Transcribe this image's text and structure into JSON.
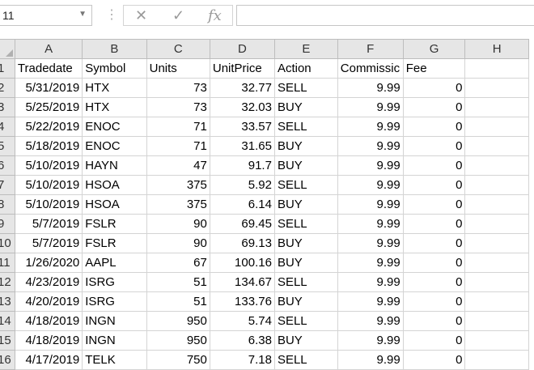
{
  "formula_bar": {
    "name_box": "11",
    "cancel_glyph": "✕",
    "enter_glyph": "✓",
    "fx_label": "fx",
    "formula": ""
  },
  "columns": [
    "A",
    "B",
    "C",
    "D",
    "E",
    "F",
    "G",
    "H"
  ],
  "row_numbers": [
    "1",
    "2",
    "3",
    "4",
    "5",
    "6",
    "7",
    "8",
    "9",
    "10",
    "11",
    "12",
    "13",
    "14",
    "15",
    "16"
  ],
  "header_row": [
    "Tradedate",
    "Symbol",
    "Units",
    "UnitPrice",
    "Action",
    "Commissic",
    "Fee",
    ""
  ],
  "rows": [
    [
      "5/31/2019",
      "HTX",
      "73",
      "32.77",
      "SELL",
      "9.99",
      "0",
      ""
    ],
    [
      "5/25/2019",
      "HTX",
      "73",
      "32.03",
      "BUY",
      "9.99",
      "0",
      ""
    ],
    [
      "5/22/2019",
      "ENOC",
      "71",
      "33.57",
      "SELL",
      "9.99",
      "0",
      ""
    ],
    [
      "5/18/2019",
      "ENOC",
      "71",
      "31.65",
      "BUY",
      "9.99",
      "0",
      ""
    ],
    [
      "5/10/2019",
      "HAYN",
      "47",
      "91.7",
      "BUY",
      "9.99",
      "0",
      ""
    ],
    [
      "5/10/2019",
      "HSOA",
      "375",
      "5.92",
      "SELL",
      "9.99",
      "0",
      ""
    ],
    [
      "5/10/2019",
      "HSOA",
      "375",
      "6.14",
      "BUY",
      "9.99",
      "0",
      ""
    ],
    [
      "5/7/2019",
      "FSLR",
      "90",
      "69.45",
      "SELL",
      "9.99",
      "0",
      ""
    ],
    [
      "5/7/2019",
      "FSLR",
      "90",
      "69.13",
      "BUY",
      "9.99",
      "0",
      ""
    ],
    [
      "1/26/2020",
      "AAPL",
      "67",
      "100.16",
      "BUY",
      "9.99",
      "0",
      ""
    ],
    [
      "4/23/2019",
      "ISRG",
      "51",
      "134.67",
      "SELL",
      "9.99",
      "0",
      ""
    ],
    [
      "4/20/2019",
      "ISRG",
      "51",
      "133.76",
      "BUY",
      "9.99",
      "0",
      ""
    ],
    [
      "4/18/2019",
      "INGN",
      "950",
      "5.74",
      "SELL",
      "9.99",
      "0",
      ""
    ],
    [
      "4/18/2019",
      "INGN",
      "950",
      "6.38",
      "BUY",
      "9.99",
      "0",
      ""
    ],
    [
      "4/17/2019",
      "TELK",
      "750",
      "7.18",
      "SELL",
      "9.99",
      "0",
      ""
    ]
  ]
}
